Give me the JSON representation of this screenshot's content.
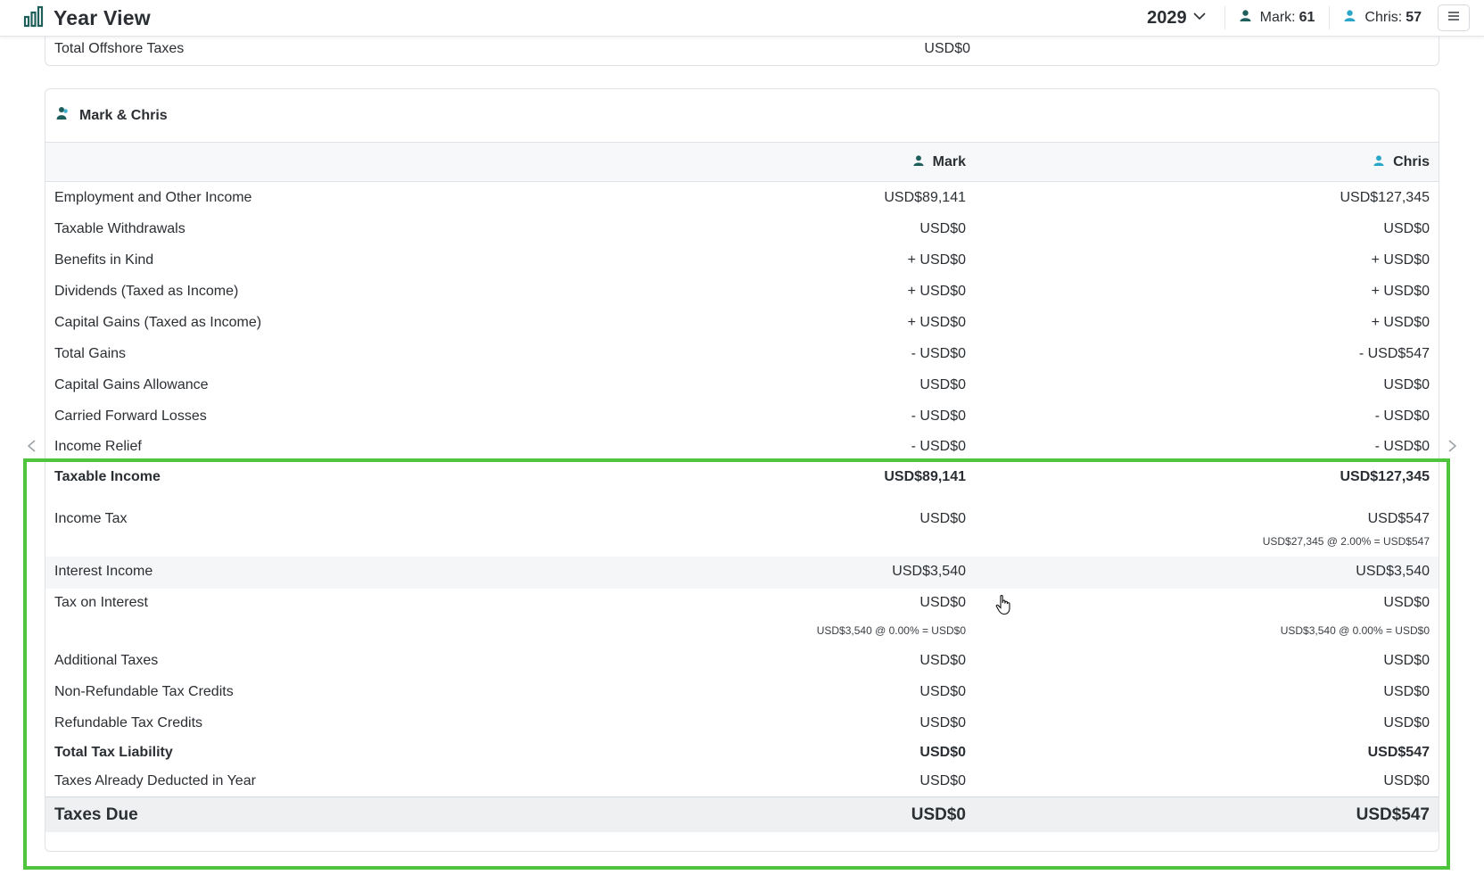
{
  "header": {
    "title": "Year View",
    "year": "2029",
    "mark_label": "Mark:",
    "mark_age": "61",
    "chris_label": "Chris:",
    "chris_age": "57",
    "colors": {
      "mark": "#1f5f5b",
      "chris": "#2aa6c8"
    }
  },
  "offshore": {
    "label": "Total Offshore Taxes",
    "value": "USD$0"
  },
  "card": {
    "title": "Mark & Chris",
    "col_mark": "Mark",
    "col_chris": "Chris",
    "rows": [
      {
        "label": "Employment and Other Income",
        "mark": "USD$89,141",
        "chris": "USD$127,345"
      },
      {
        "label": "Taxable Withdrawals",
        "mark": "USD$0",
        "chris": "USD$0"
      },
      {
        "label": "Benefits in Kind",
        "mark": "+ USD$0",
        "chris": "+ USD$0"
      },
      {
        "label": "Dividends (Taxed as Income)",
        "mark": "+ USD$0",
        "chris": "+ USD$0"
      },
      {
        "label": "Capital Gains (Taxed as Income)",
        "mark": "+ USD$0",
        "chris": "+ USD$0"
      },
      {
        "label": "Total Gains",
        "mark": "- USD$0",
        "chris": "- USD$547"
      },
      {
        "label": "Capital Gains Allowance",
        "mark": "USD$0",
        "chris": "USD$0"
      },
      {
        "label": "Carried Forward Losses",
        "mark": "- USD$0",
        "chris": "- USD$0"
      },
      {
        "label": "Income Relief",
        "mark": "- USD$0",
        "chris": "- USD$0"
      },
      {
        "label": "Taxable Income",
        "mark": "USD$89,141",
        "chris": "USD$127,345"
      },
      {
        "label": "Income Tax",
        "mark": "USD$0",
        "chris": "USD$547"
      },
      {
        "label": "",
        "mark": "",
        "chris": "USD$27,345 @ 2.00% = USD$547"
      },
      {
        "label": "Interest Income",
        "mark": "USD$3,540",
        "chris": "USD$3,540"
      },
      {
        "label": "Tax on Interest",
        "mark": "USD$0",
        "chris": "USD$0"
      },
      {
        "label": "",
        "mark": "USD$3,540 @ 0.00% = USD$0",
        "chris": "USD$3,540 @ 0.00% = USD$0"
      },
      {
        "label": "Additional Taxes",
        "mark": "USD$0",
        "chris": "USD$0"
      },
      {
        "label": "Non-Refundable Tax Credits",
        "mark": "USD$0",
        "chris": "USD$0"
      },
      {
        "label": "Refundable Tax Credits",
        "mark": "USD$0",
        "chris": "USD$0"
      },
      {
        "label": "Total Tax Liability",
        "mark": "USD$0",
        "chris": "USD$547"
      },
      {
        "label": "Taxes Already Deducted in Year",
        "mark": "USD$0",
        "chris": "USD$0"
      },
      {
        "label": "Taxes Due",
        "mark": "USD$0",
        "chris": "USD$547"
      }
    ]
  }
}
